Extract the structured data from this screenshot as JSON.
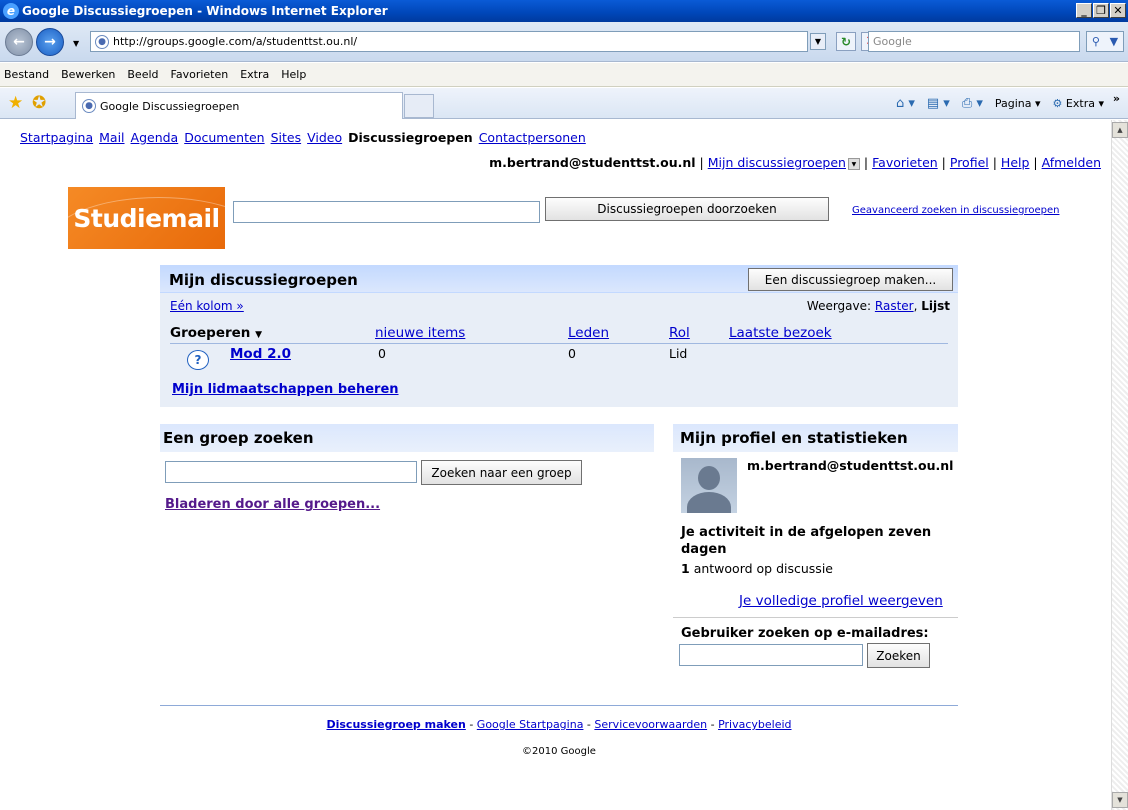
{
  "window": {
    "title": "Google Discussiegroepen - Windows Internet Explorer",
    "controls": [
      "_",
      "❐",
      "✕"
    ]
  },
  "browser": {
    "url": "http://groups.google.com/a/studenttst.ou.nl/",
    "search_placeholder": "Google",
    "menu": [
      "Bestand",
      "Bewerken",
      "Beeld",
      "Favorieten",
      "Extra",
      "Help"
    ],
    "tab_title": "Google Discussiegroepen",
    "cmd": {
      "pagina": "Pagina",
      "extra": "Extra"
    }
  },
  "gbar": {
    "items": [
      "Startpagina",
      "Mail",
      "Agenda",
      "Documenten",
      "Sites",
      "Video"
    ],
    "current": "Discussiegroepen",
    "last": "Contactpersonen"
  },
  "user": {
    "email": "m.bertrand@studenttst.ou.nl",
    "my_groups": "Mijn discussiegroepen",
    "favorites": "Favorieten",
    "profile": "Profiel",
    "help": "Help",
    "signout": "Afmelden"
  },
  "search": {
    "logo": "Studiemail",
    "button": "Discussiegroepen doorzoeken",
    "advanced": "Geavanceerd zoeken in discussiegroepen"
  },
  "my_groups": {
    "title": "Mijn discussiegroepen",
    "make_button": "Een discussiegroep maken...",
    "one_column": "Eén kolom »",
    "view_label": "Weergave:",
    "view_grid": "Raster",
    "view_list": "Lijst",
    "col_group": "Groeperen",
    "col_new": "nieuwe items",
    "col_members": "Leden",
    "col_role": "Rol",
    "col_last": "Laatste bezoek",
    "rows": [
      {
        "name": "Mod 2.0",
        "new": "0",
        "members": "0",
        "role": "Lid"
      }
    ],
    "manage": "Mijn lidmaatschappen beheren"
  },
  "find_group": {
    "title": "Een groep zoeken",
    "button": "Zoeken naar een groep",
    "browse": "Bladeren door alle groepen..."
  },
  "profile": {
    "title": "Mijn profiel en statistieken",
    "email": "m.bertrand@studenttst.ou.nl",
    "activity": "Je activiteit in de afgelopen zeven dagen",
    "answers_count": "1",
    "answers_text": "antwoord op discussie",
    "full_profile": "Je volledige profiel weergeven",
    "email_search_label": "Gebruiker zoeken op e-mailadres:",
    "email_search_button": "Zoeken"
  },
  "footer": {
    "make": "Discussiegroep maken",
    "home": "Google Startpagina",
    "terms": "Servicevoorwaarden",
    "privacy": "Privacybeleid",
    "copyright": "©2010 Google"
  }
}
